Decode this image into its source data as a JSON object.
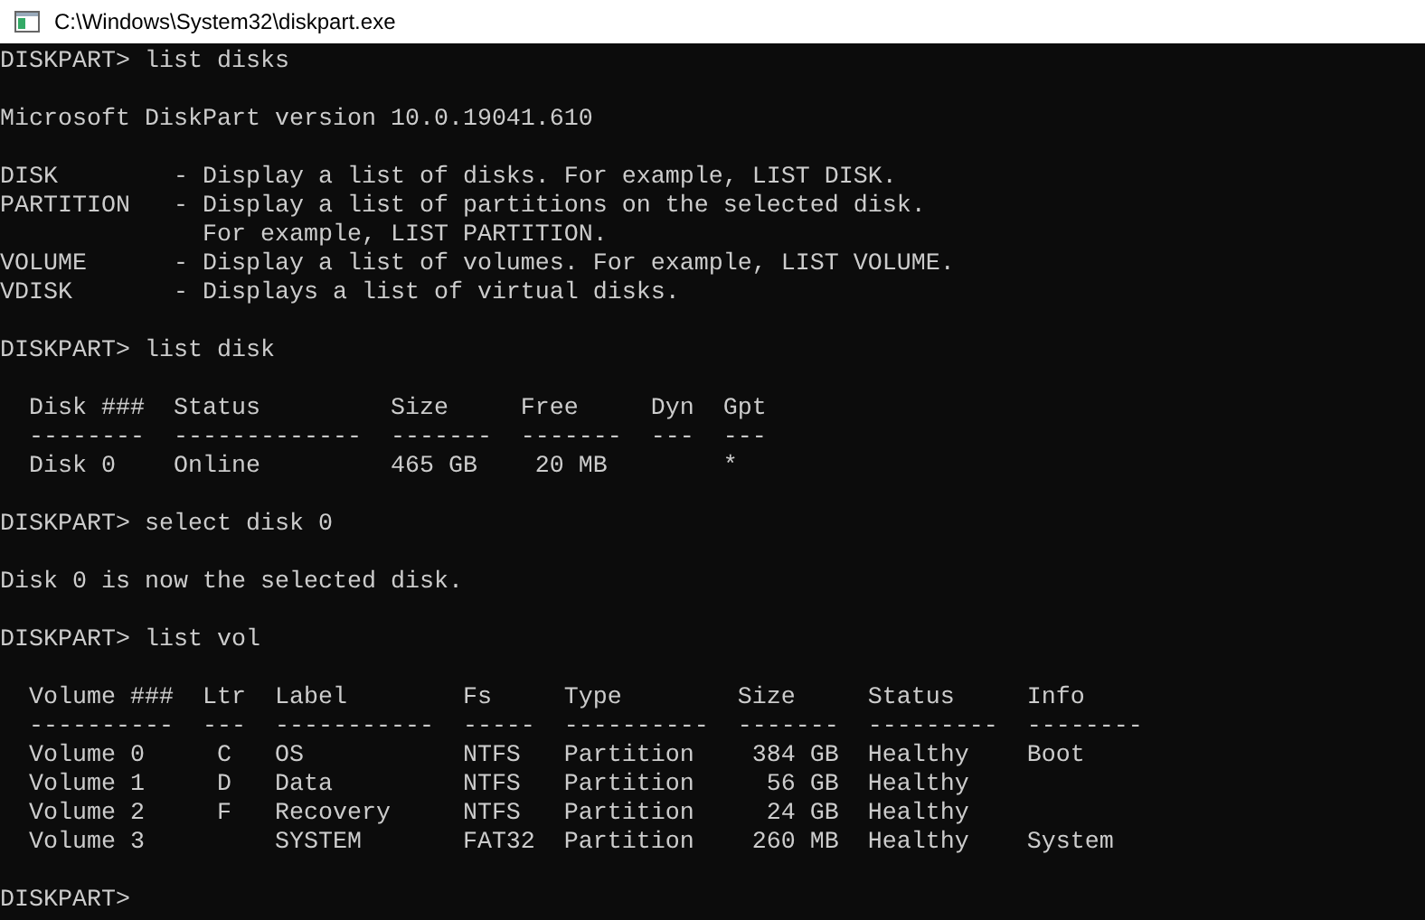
{
  "window": {
    "title": "C:\\Windows\\System32\\diskpart.exe"
  },
  "console": {
    "blocks": [
      [
        "DISKPART> list disks"
      ],
      [
        "Microsoft DiskPart version 10.0.19041.610"
      ],
      [
        "DISK        - Display a list of disks. For example, LIST DISK.",
        "PARTITION   - Display a list of partitions on the selected disk.",
        "              For example, LIST PARTITION.",
        "VOLUME      - Display a list of volumes. For example, LIST VOLUME.",
        "VDISK       - Displays a list of virtual disks."
      ],
      [
        "DISKPART> list disk"
      ],
      [
        "  Disk ###  Status         Size     Free     Dyn  Gpt",
        "  --------  -------------  -------  -------  ---  ---",
        "  Disk 0    Online         465 GB    20 MB        *"
      ],
      [
        "DISKPART> select disk 0"
      ],
      [
        "Disk 0 is now the selected disk."
      ],
      [
        "DISKPART> list vol"
      ],
      [
        "  Volume ###  Ltr  Label        Fs     Type        Size     Status     Info",
        "  ----------  ---  -----------  -----  ----------  -------  ---------  --------",
        "  Volume 0     C   OS           NTFS   Partition    384 GB  Healthy    Boot",
        "  Volume 1     D   Data         NTFS   Partition     56 GB  Healthy",
        "  Volume 2     F   Recovery     NTFS   Partition     24 GB  Healthy",
        "  Volume 3         SYSTEM       FAT32  Partition    260 MB  Healthy    System"
      ],
      [
        "DISKPART>"
      ]
    ]
  }
}
